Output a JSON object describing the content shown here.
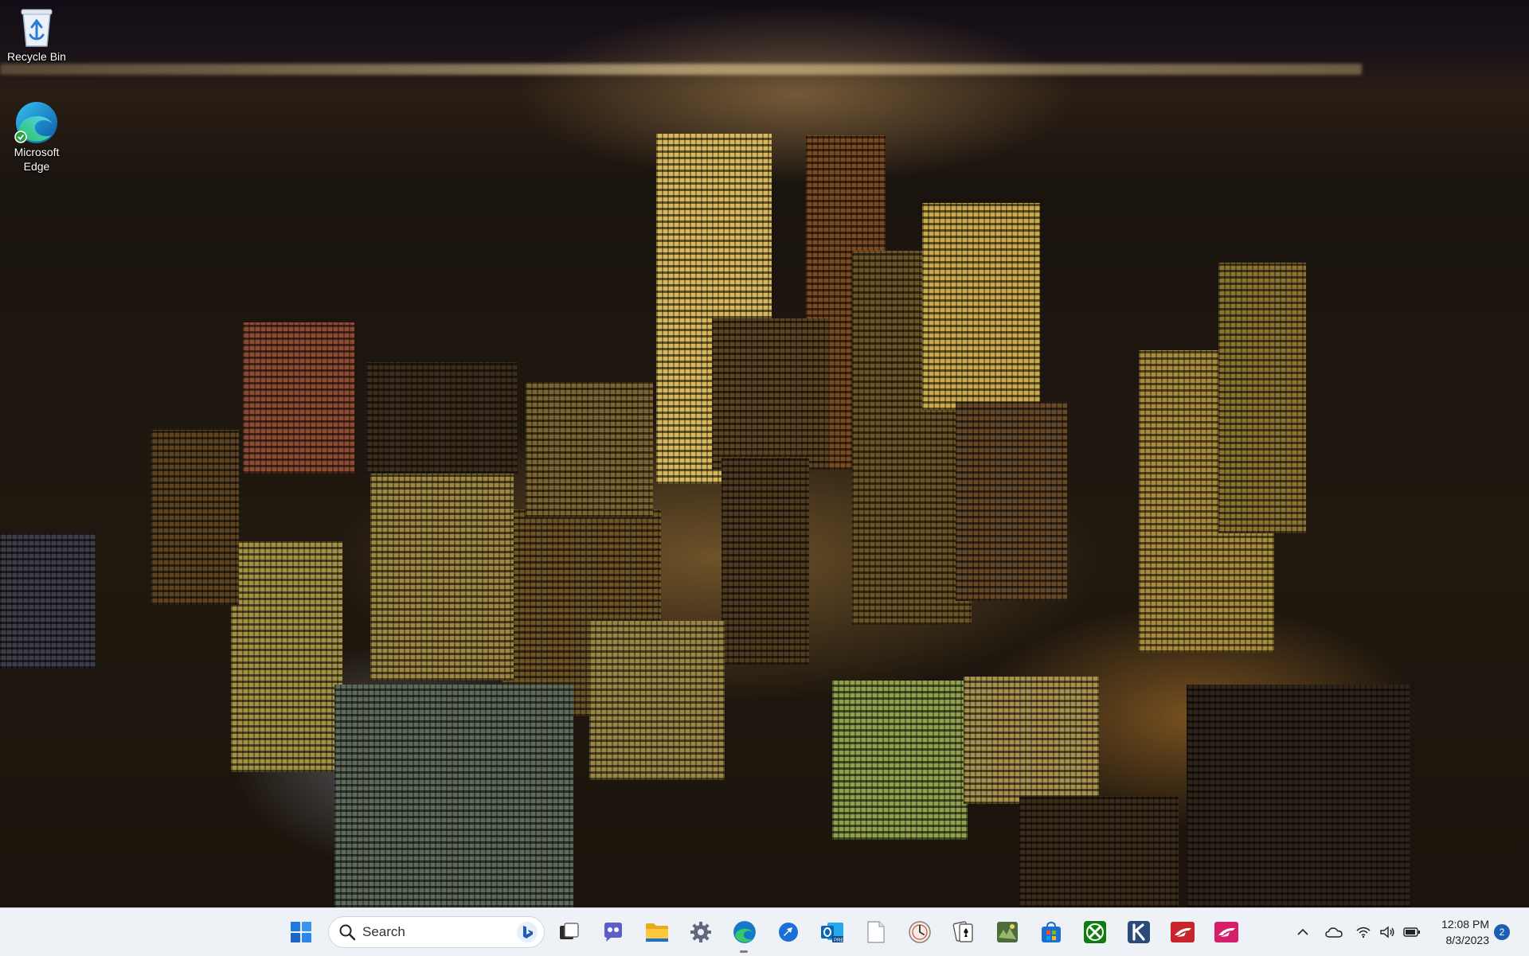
{
  "desktop": {
    "icons": [
      {
        "label": "Recycle Bin",
        "icon": "recycle-bin-icon"
      },
      {
        "label": "Microsoft Edge",
        "icon": "edge-icon"
      }
    ],
    "wallpaper": "night-city-skyline"
  },
  "taskbar": {
    "search": {
      "placeholder": "Search"
    },
    "apps": [
      {
        "name": "start",
        "icon": "windows-start-icon"
      },
      {
        "name": "task-view",
        "icon": "task-view-icon"
      },
      {
        "name": "chat",
        "icon": "chat-icon"
      },
      {
        "name": "file-explorer",
        "icon": "folder-icon"
      },
      {
        "name": "settings",
        "icon": "gear-icon"
      },
      {
        "name": "edge",
        "icon": "edge-icon",
        "active": true
      },
      {
        "name": "quick-assist",
        "icon": "quick-assist-icon"
      },
      {
        "name": "outlook",
        "icon": "outlook-icon"
      },
      {
        "name": "notepad",
        "icon": "notepad-icon"
      },
      {
        "name": "clock",
        "icon": "clock-icon"
      },
      {
        "name": "solitaire",
        "icon": "solitaire-icon"
      },
      {
        "name": "game",
        "icon": "game-icon"
      },
      {
        "name": "store",
        "icon": "store-icon"
      },
      {
        "name": "xbox",
        "icon": "xbox-icon"
      },
      {
        "name": "k-app",
        "icon": "k-icon"
      },
      {
        "name": "forza-1",
        "icon": "forza-icon"
      },
      {
        "name": "forza-2",
        "icon": "forza-icon"
      }
    ],
    "tray": {
      "icons": [
        "chevron-up-icon",
        "onedrive-icon",
        "wifi-icon",
        "volume-icon",
        "battery-icon"
      ],
      "time": "12:08 PM",
      "date": "8/3/2023",
      "notifications": "2"
    }
  },
  "colors": {
    "taskbar_bg": "#eef1f6",
    "accent": "#1a5fb4"
  }
}
